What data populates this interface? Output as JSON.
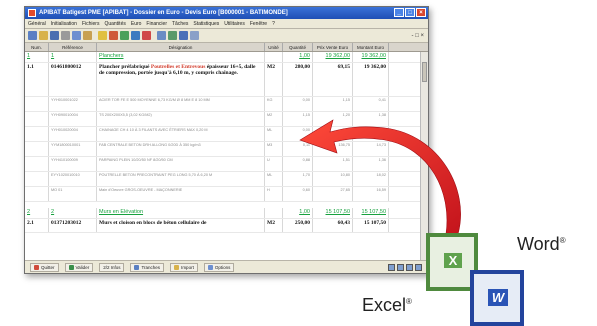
{
  "window": {
    "title": "APIBAT Batigest PME [APIBAT] - Dossier en Euro - Devis Euro [B000001 - BATIMONDE]",
    "controls": [
      "_",
      "□",
      "×"
    ]
  },
  "menu": [
    "Général",
    "Initialisation",
    "Fichiers",
    "Quantités",
    "Euro",
    "Financier",
    "Tâches",
    "Statistiques",
    "Utilitaires",
    "Fenêtre",
    "?"
  ],
  "grid": {
    "headers": [
      "Num.",
      "Référence",
      "Désignation",
      "Unité",
      "Quantité",
      "Prix Vente Euro",
      "Montant Euro"
    ],
    "rows": [
      {
        "type": "section",
        "num": "1",
        "ref": "1",
        "des": "Planchers",
        "unit": "",
        "qty": "1,00",
        "pv": "19 362,00",
        "mt": "19 362,00"
      },
      {
        "type": "item",
        "num": "1.1",
        "ref": "01461800012",
        "des_a": "Plancher préfabriqué ",
        "des_red": "Poutrelles et Entrevous",
        "des_b": " épaisseur 16+5, dalle de compression, portée jusqu'à 6,10 m, y compris chaînage.",
        "unit": "M2",
        "qty": "280,00",
        "pv": "69,15",
        "mt": "19 362,00"
      },
      {
        "type": "sub",
        "num": "",
        "ref": "YYH010001022",
        "des": "ACIER TOR FE E 500 MOYENNE 6,73 KG/M Ø 8 MM E 8 10 MM",
        "unit": "KG",
        "qty": "0,00",
        "pv": "1,15",
        "mt": "0,41"
      },
      {
        "type": "sub",
        "num": "",
        "ref": "YYH090010004",
        "des": "TS 200X200X5,5 (3,02 KG/M2)",
        "unit": "M2",
        "qty": "1,15",
        "pv": "1,20",
        "mt": "1,38"
      },
      {
        "type": "sub",
        "num": "",
        "ref": "YYH010020004",
        "des": "CHAINAGE CH 4 10 À 3 FILANTS AVEC ÉTRIERS MAX 0,20 M",
        "unit": "ML",
        "qty": "0,00",
        "pv": "1,20",
        "mt": "5,58"
      },
      {
        "type": "sub",
        "num": "",
        "ref": "YYM1800010001",
        "des": "FAB CENTRALE BETON DRH ALLONG 0/20D À 350 kg/m3",
        "unit": "M3",
        "qty": "0,11",
        "pv": "136,75",
        "mt": "14,73"
      },
      {
        "type": "sub",
        "num": "",
        "ref": "YYH410100009",
        "des": "PARPAING PLEIN 10/20/50 NF 8/20/50 CM",
        "unit": "U",
        "qty": "0,88",
        "pv": "1,51",
        "mt": "1,36"
      },
      {
        "type": "sub",
        "num": "",
        "ref": "EYY1020010010",
        "des": "POUTRELLE BETON PRECONTRAINT PEG LONG 5,70 À 6,20 M",
        "unit": "ML",
        "qty": "1,70",
        "pv": "10,80",
        "mt": "18,02"
      },
      {
        "type": "sub",
        "num": "",
        "ref": "MO 01",
        "des": "Main d'Oeuvre GROS-OEUVRE - MAÇONNERIE",
        "unit": "H",
        "qty": "0,60",
        "pv": "27,65",
        "mt": "16,59"
      },
      {
        "type": "section",
        "num": "2",
        "ref": "2",
        "des": "Murs en Elévation",
        "unit": "",
        "qty": "1,00",
        "pv": "15 107,50",
        "mt": "15 107,50"
      },
      {
        "type": "item2",
        "num": "2.1",
        "ref": "01371203012",
        "des": "Murs et cloison en blocs de béton cellulaire de",
        "unit": "M2",
        "qty": "250,00",
        "pv": "60,43",
        "mt": "15 107,50"
      }
    ]
  },
  "statusbar": {
    "buttons": [
      "Quitter",
      "Valider",
      "2/2 Infos",
      "Tranches",
      "Import",
      "Options"
    ]
  },
  "word": {
    "label": "Word",
    "reg": "®",
    "glyph": "W"
  },
  "excel": {
    "label": "Excel",
    "reg": "®",
    "glyph": "X"
  },
  "colors": {
    "arrow": "#e21f26",
    "title_bar": "#2a5ec8",
    "section_green": "#17a13e",
    "excel_green": "#4f8a3e",
    "word_blue": "#23449d"
  }
}
